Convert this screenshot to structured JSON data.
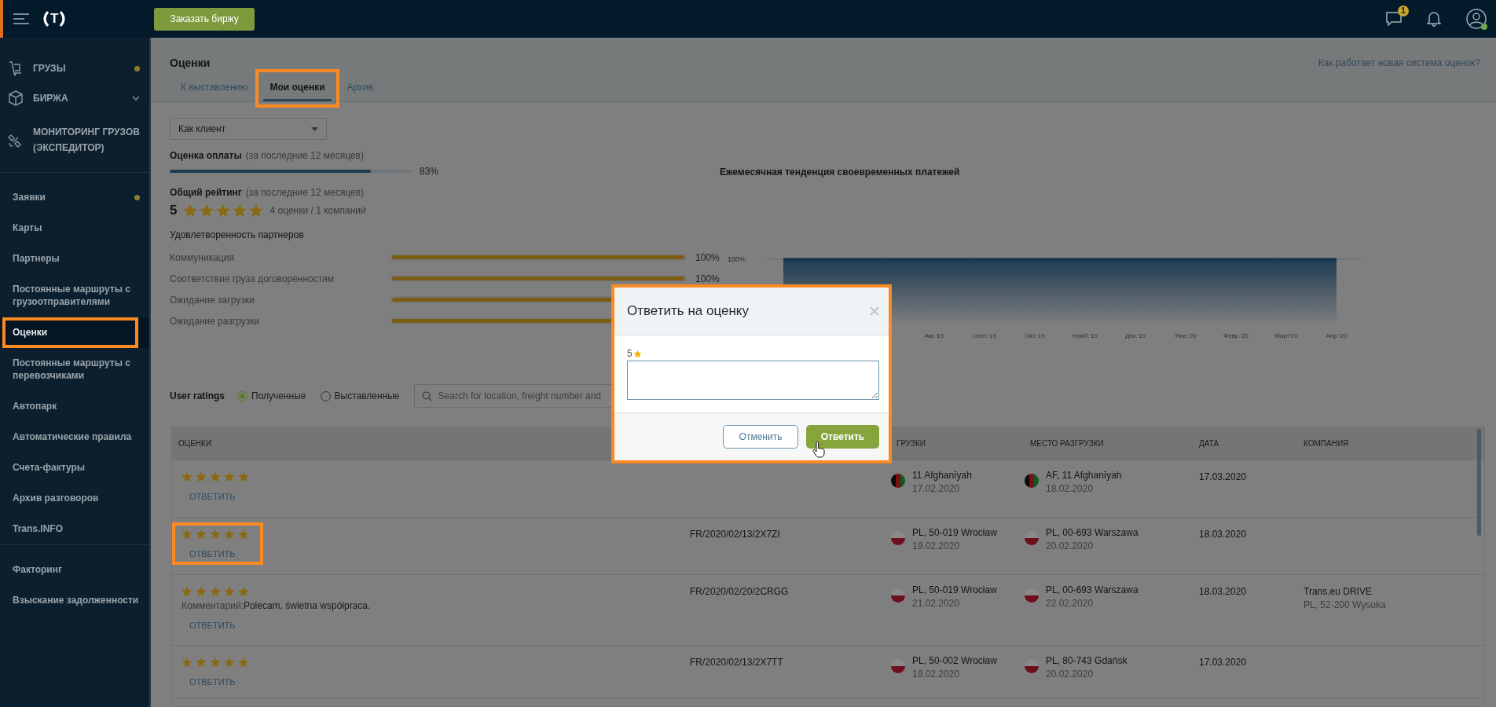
{
  "top_bar": {
    "logo": "T",
    "order_button": "Заказать биржу",
    "chat_badge": "1"
  },
  "sidebar": {
    "main_items": [
      {
        "label": "ГРУЗЫ",
        "dot": true,
        "expandable": false
      },
      {
        "label": "БИРЖА",
        "dot": false,
        "expandable": true
      },
      {
        "label": "МОНИТОРИНГ ГРУЗОВ (ЭКСПЕДИТОР)",
        "dot": false,
        "expandable": false
      }
    ],
    "items": [
      {
        "label": "Заявки",
        "dot": true,
        "selected": false,
        "highlighted": false
      },
      {
        "label": "Карты",
        "dot": false,
        "selected": false,
        "highlighted": false
      },
      {
        "label": "Партнеры",
        "dot": false,
        "selected": false,
        "highlighted": false
      },
      {
        "label": "Постоянные маршруты с грузоотправителями",
        "dot": false,
        "selected": false,
        "highlighted": false
      },
      {
        "label": "Оценки",
        "dot": false,
        "selected": true,
        "highlighted": true
      },
      {
        "label": "Постоянные маршруты с перевозчиками",
        "dot": false,
        "selected": false,
        "highlighted": false
      },
      {
        "label": "Автопарк",
        "dot": false,
        "selected": false,
        "highlighted": false
      },
      {
        "label": "Автоматические правила",
        "dot": false,
        "selected": false,
        "highlighted": false
      },
      {
        "label": "Счета-фактуры",
        "dot": false,
        "selected": false,
        "highlighted": false
      },
      {
        "label": "Архив разговоров",
        "dot": false,
        "selected": false,
        "highlighted": false
      },
      {
        "label": "Trans.INFO",
        "dot": false,
        "selected": false,
        "highlighted": false
      }
    ],
    "extra_items": [
      {
        "label": "Факторинг",
        "selected": false
      },
      {
        "label": "Взыскание задолженности",
        "selected": false
      }
    ]
  },
  "page": {
    "title": "Оценки",
    "help_link": "Как работает новая система оценок?",
    "tabs": [
      {
        "label": "К выставлению",
        "selected": false,
        "highlighted": false
      },
      {
        "label": "Мои оценки",
        "selected": true,
        "highlighted": true
      },
      {
        "label": "Архив",
        "selected": false,
        "highlighted": false
      }
    ]
  },
  "role_select": {
    "value": "Как клиент"
  },
  "payment": {
    "label": "Оценка оплаты",
    "period": "(за последние 12 месяцев)",
    "level": 0.83,
    "reading": "83%"
  },
  "overall": {
    "label": "Общий рейтинг",
    "period": "(за последние 12 месяцев)",
    "score": "5",
    "stars": 5,
    "summary": "4 оценки / 1 компаний"
  },
  "satisfaction": {
    "title": "Удовлетворенность партнеров",
    "rows": [
      {
        "label": "Коммуникация",
        "level": 1,
        "reading": "100%"
      },
      {
        "label": "Соответствие груза договоренностям",
        "level": 1,
        "reading": "100%"
      },
      {
        "label": "Ожидание загрузки",
        "level": 1
      },
      {
        "label": "Ожидание разгрузки",
        "level": 1
      }
    ]
  },
  "chart": {
    "title": "Ежемесячная тенденция своевременных платежей",
    "y_label": "100%",
    "x_labels": [
      "Авг.'19",
      "Сент.'19",
      "Окт.'19",
      "Нояб.'19",
      "Дек.'19",
      "Янв.'20",
      "Февр.'20",
      "Март'20",
      "Апр.'20"
    ]
  },
  "ratings": {
    "title": "User ratings",
    "filters": [
      {
        "label": "Полученные",
        "selected": true
      },
      {
        "label": "Выставленные",
        "selected": false
      }
    ],
    "search": {
      "placeholder": "Search for location, freight number and"
    }
  },
  "table": {
    "column_headers": {
      "ratings": "ОЦЕНКИ",
      "column_3": "ГРУЗКИ",
      "unloading_place": "МЕСТО РАЗГРУЗКИ",
      "date": "ДАТА",
      "company": "КОМПАНИЯ"
    },
    "rows": [
      {
        "stars": 5,
        "reply": "ОТВЕТИТЬ",
        "highlighted": false,
        "loading": {
          "kind": "af",
          "place": "11 Afghanīyah",
          "date": "17.02.2020"
        },
        "unloading": {
          "kind": "af",
          "place": "AF, 11 Afghanīyah",
          "date": "18.02.2020"
        },
        "date": "17.03.2020"
      },
      {
        "stars": 5,
        "reply": "ОТВЕТИТЬ",
        "highlighted": true,
        "freight": "FR/2020/02/13/2X7ZI",
        "loading": {
          "kind": "pl",
          "place": "PL, 50-019 Wrocław",
          "date": "19.02.2020"
        },
        "unloading": {
          "kind": "pl",
          "place": "PL, 00-693 Warszawa",
          "date": "20.02.2020"
        },
        "date": "18.03.2020"
      },
      {
        "stars": 5,
        "reply": "ОТВЕТИТЬ",
        "highlighted": false,
        "comment_label": "Комментарий:",
        "comment": "Polecam, świetna współpraca.",
        "freight": "FR/2020/02/20/2CRGG",
        "loading": {
          "kind": "pl",
          "place": "PL, 50-019 Wrocław",
          "date": "21.02.2020"
        },
        "unloading": {
          "kind": "pl",
          "place": "PL, 00-693 Warszawa",
          "date": "22.02.2020"
        },
        "date": "18.03.2020",
        "company": "Trans.eu DRIVE",
        "company_address": "PL, 52-200 Wysoka"
      },
      {
        "stars": 5,
        "reply": "ОТВЕТИТЬ",
        "highlighted": false,
        "freight": "FR/2020/02/13/2X7TT",
        "loading": {
          "kind": "pl",
          "place": "PL, 50-002 Wrocław",
          "date": "19.02.2020"
        },
        "unloading": {
          "kind": "pl",
          "place": "PL, 80-743 Gdańsk",
          "date": "20.02.2020"
        },
        "date": "17.03.2020"
      }
    ]
  },
  "modal": {
    "title": "Ответить на оценку",
    "rating": "5",
    "cancel_button": "Отменить",
    "submit_button": "Ответить",
    "highlighted": true
  }
}
